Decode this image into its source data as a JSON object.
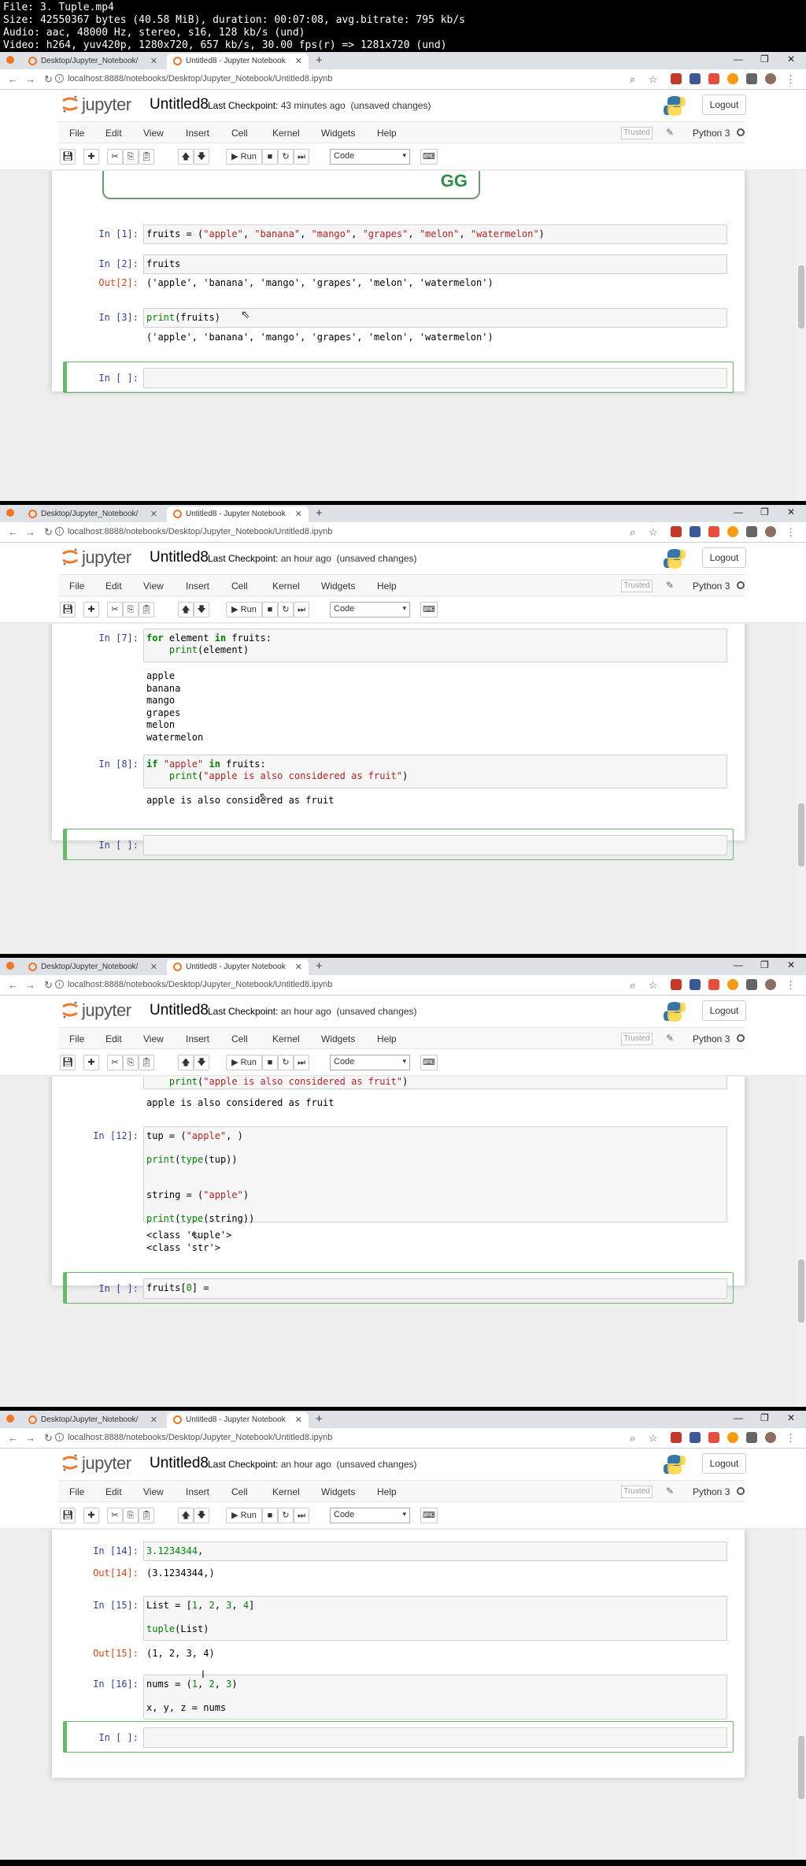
{
  "video_info": {
    "line1": "File: 3. Tuple.mp4",
    "line2": "Size: 42550367 bytes (40.58 MiB), duration: 00:07:08, avg.bitrate: 795 kb/s",
    "line3": "Audio: aac, 48000 Hz, stereo, s16, 128 kb/s (und)",
    "line4": "Video: h264, yuv420p, 1280x720, 657 kb/s, 30.00 fps(r) => 1281x720 (und)"
  },
  "browser": {
    "tab1": "Desktop/Jupyter_Notebook/",
    "tab2": "Untitled8 - Jupyter Notebook",
    "url": "localhost:8888/notebooks/Desktop/Jupyter_Notebook/Untitled8.ipynb"
  },
  "jupyter": {
    "logo_text": "jupyter",
    "title": "Untitled8",
    "checkpoint_label": "Last Checkpoint:",
    "logout": "Logout",
    "trusted": "Trusted",
    "kernel": "Python 3",
    "run": "Run",
    "cell_type": "Code",
    "menu": [
      "File",
      "Edit",
      "View",
      "Insert",
      "Cell",
      "Kernel",
      "Widgets",
      "Help"
    ]
  },
  "frames": [
    {
      "checkpoint": "43 minutes ago",
      "status": "(unsaved changes)",
      "cells": [
        {
          "prompt": "In [1]:",
          "code": "fruits = (\"apple\", \"banana\", \"mango\", \"grapes\", \"melon\", \"watermelon\")"
        },
        {
          "prompt": "In [2]:",
          "code": "fruits"
        },
        {
          "out_prompt": "Out[2]:",
          "output": "('apple', 'banana', 'mango', 'grapes', 'melon', 'watermelon')"
        },
        {
          "prompt": "In [3]:",
          "code": "print(fruits)"
        },
        {
          "output": "('apple', 'banana', 'mango', 'grapes', 'melon', 'watermelon')"
        },
        {
          "prompt": "In [ ]:",
          "code": ""
        }
      ],
      "logo_mark": "GG"
    },
    {
      "checkpoint": "an hour ago",
      "status": "(unsaved changes)",
      "cells": [
        {
          "prompt": "In [7]:",
          "code": "for element in fruits:\n    print(element)"
        },
        {
          "output": "apple\nbanana\nmango\ngrapes\nmelon\nwatermelon"
        },
        {
          "prompt": "In [8]:",
          "code": "if \"apple\" in fruits:\n    print(\"apple is also considered as fruit\")"
        },
        {
          "output": "apple is also considered as fruit"
        },
        {
          "prompt": "In [ ]:",
          "code": ""
        }
      ]
    },
    {
      "checkpoint": "an hour ago",
      "status": "(unsaved changes)",
      "cells": [
        {
          "code": "    print(\"apple is also considered as fruit\")"
        },
        {
          "output": "apple is also considered as fruit"
        },
        {
          "prompt": "In [12]:",
          "code": "tup = (\"apple\", )\n\nprint(type(tup))\n\n\nstring = (\"apple\")\n\nprint(type(string))"
        },
        {
          "output": "<class 'tuple'>\n<class 'str'>"
        },
        {
          "prompt": "In [ ]:",
          "code": "fruits[0] ="
        }
      ]
    },
    {
      "checkpoint": "an hour ago",
      "status": "(unsaved changes)",
      "cells": [
        {
          "prompt": "In [14]:",
          "code": "3.1234344,"
        },
        {
          "out_prompt": "Out[14]:",
          "output": "(3.1234344,)"
        },
        {
          "prompt": "In [15]:",
          "code": "List = [1, 2, 3, 4]\n\ntuple(List)"
        },
        {
          "out_prompt": "Out[15]:",
          "output": "(1, 2, 3, 4)"
        },
        {
          "prompt": "In [16]:",
          "code": "nums = (1, 2, 3)\n\nx, y, z = nums"
        },
        {
          "prompt": "In [ ]:",
          "code": ""
        }
      ]
    }
  ]
}
